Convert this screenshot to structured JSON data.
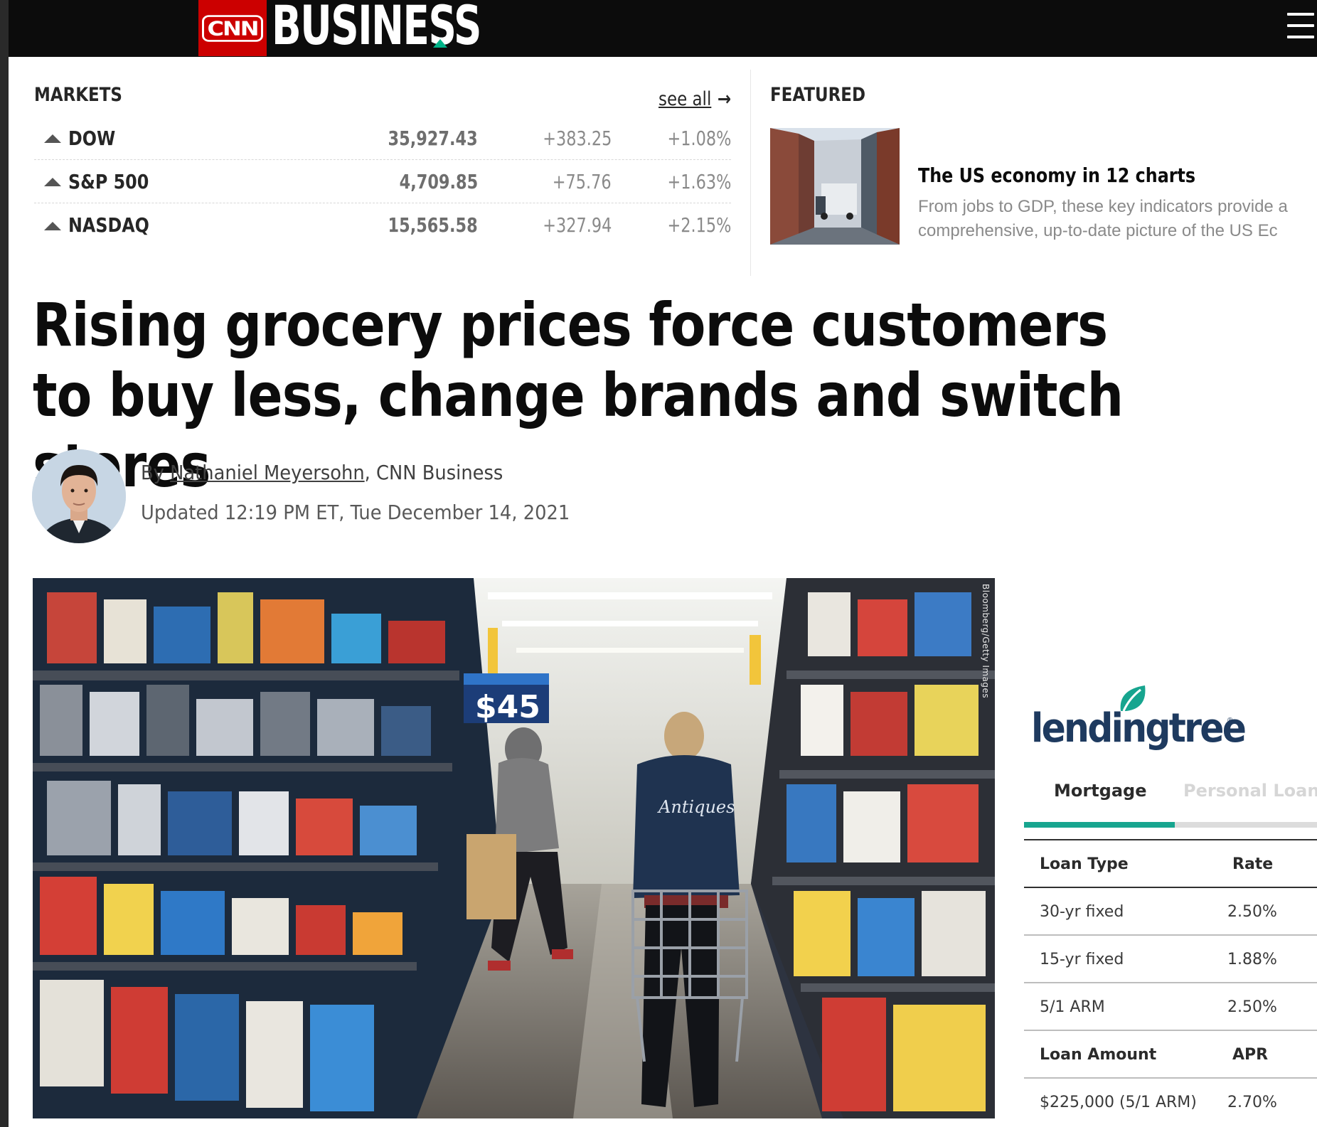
{
  "header": {
    "logo_text": "CNN",
    "section_title": "BUSINESS",
    "menu_icon": "hamburger-menu-icon",
    "accent_color": "#cc0000",
    "triangle_color": "#00b388"
  },
  "markets": {
    "label": "MARKETS",
    "see_all": "see all",
    "see_all_arrow": "→",
    "rows": [
      {
        "name": "DOW",
        "value": "35,927.43",
        "change": "+383.25",
        "pct": "+1.08%",
        "direction": "up"
      },
      {
        "name": "S&P 500",
        "value": "4,709.85",
        "change": "+75.76",
        "pct": "+1.63%",
        "direction": "up"
      },
      {
        "name": "NASDAQ",
        "value": "15,565.58",
        "change": "+327.94",
        "pct": "+2.15%",
        "direction": "up"
      }
    ]
  },
  "featured": {
    "label": "FEATURED",
    "title": "The US economy in 12 charts",
    "description_line1": "From jobs to GDP, these key indicators provide a",
    "description_line2": "comprehensive, up-to-date picture of the US Ec"
  },
  "article": {
    "headline": "Rising grocery prices force customers to buy less, change brands and switch stores",
    "byline_prefix": "By ",
    "author": "Nathaniel Meyersohn",
    "byline_suffix": ", CNN Business",
    "updated": "Updated 12:19 PM ET, Tue December 14, 2021",
    "image_price_sign": "$45",
    "image_credit": "Bloomberg/Getty Images"
  },
  "lendingtree": {
    "logo": "lendingtree",
    "brand_color": "#17a58f",
    "tabs": [
      "Mortgage",
      "Personal Loans"
    ],
    "active_tab": "Mortgage",
    "rate_header": {
      "col1": "Loan Type",
      "col2": "Rate"
    },
    "rates": [
      {
        "type": "30-yr fixed",
        "rate": "2.50%"
      },
      {
        "type": "15-yr fixed",
        "rate": "1.88%"
      },
      {
        "type": "5/1 ARM",
        "rate": "2.50%"
      }
    ],
    "apr_header": {
      "col1": "Loan Amount",
      "col2": "APR"
    },
    "apr_rows": [
      {
        "amount": "$225,000 (5/1 ARM)",
        "apr": "2.70%"
      }
    ]
  }
}
